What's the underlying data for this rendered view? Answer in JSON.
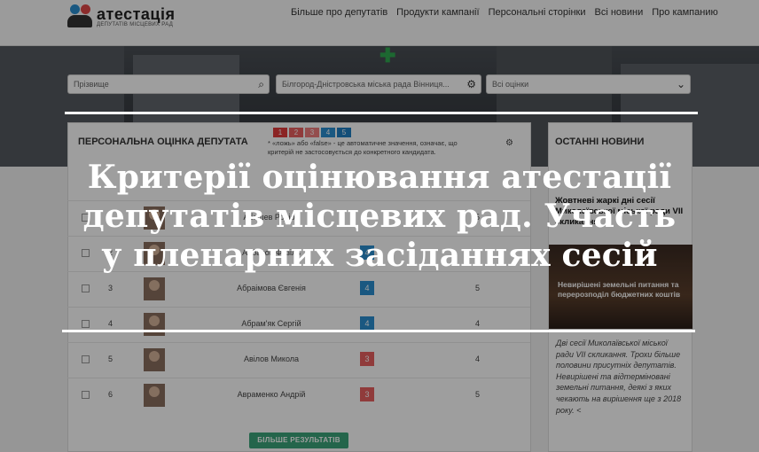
{
  "header": {
    "logo_name": "атестація",
    "logo_sub": "ДЕПУТАТІВ МІСЦЕВИХ РАД",
    "nav": [
      "Більше про депутатів",
      "Продукти кампанії",
      "Персональні сторінки",
      "Всі новини",
      "Про кампанию"
    ]
  },
  "filters": {
    "surname_placeholder": "Прізвище",
    "council": "Білгород-Дністровська міська рада   Вінниця...",
    "ratings": "Всі оцінки"
  },
  "ranking": {
    "title": "ПЕРСОНАЛЬНА ОЦІНКА ДЕПУТАТА",
    "badges": [
      "1",
      "2",
      "3",
      "4",
      "5"
    ],
    "hint": "* «ложь» або «false» - це автоматичне значення, означає, що критерій не застосовується до конкретного кандидата.",
    "rows": [
      {
        "num": "3",
        "name": "Абраімова Євгенія",
        "mark": "4",
        "score": "5"
      },
      {
        "num": "4",
        "name": "Абрам'як Сергій",
        "mark": "4",
        "score": "4"
      },
      {
        "num": "5",
        "name": "Авілов Микола",
        "mark": "3",
        "score": "4"
      },
      {
        "num": "6",
        "name": "Авраменко Андрій",
        "mark": "3",
        "score": "5"
      }
    ],
    "row_top": [
      {
        "num": "",
        "name": "Абашев Родіон",
        "score": "5"
      },
      {
        "num": "2",
        "name": "Аббасов Фазіль",
        "mark": "4",
        "score": "5"
      }
    ],
    "more_button": "БІЛЬШЕ РЕЗУЛЬТАТІВ"
  },
  "news": {
    "title": "ОСТАННІ НОВИНИ",
    "headline": "Жовтневі жаркі дні сесії Миколаївської міської ради VII скликання",
    "image_caption": "Невирішені земельні питання та перерозподіл бюджетних коштів",
    "text": "Дві сесії Миколаївської міської ради VII скликання. Трохи більше половини присутніх депутатів. Невирішені та відтерміновані земельні питання, деякі з яких чекають на вирішення ще з 2018 року. <"
  },
  "overlay": {
    "lines": [
      "Критерії оцінювання атестації",
      "депутатів місцевих рад. Участь",
      "у пленарних засіданнях сесій"
    ]
  },
  "colors": {
    "badge1": "#e03b3b",
    "badge2": "#e86060",
    "badge3": "#ef7f7f",
    "badge4": "#2a8fd0",
    "badge5": "#1f7fc2",
    "green": "#3aa47a"
  }
}
